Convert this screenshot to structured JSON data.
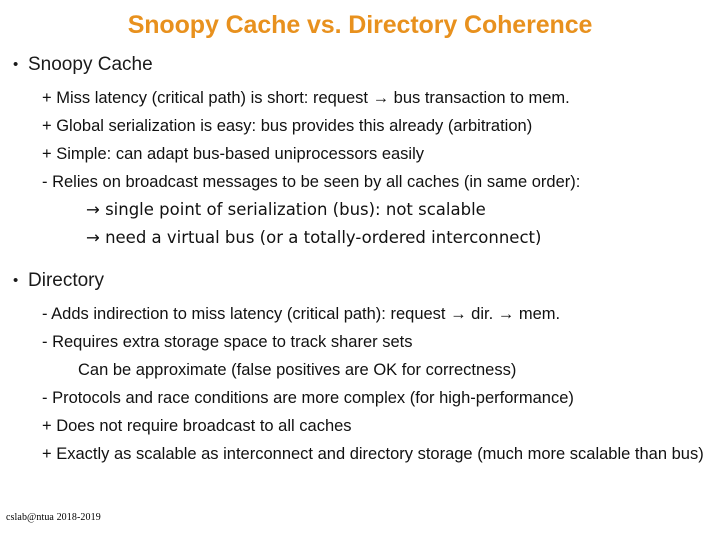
{
  "slide": {
    "title": "Snoopy Cache vs. Directory Coherence",
    "title_color": "#E8911E",
    "background_color": "#FFFFFF",
    "text_color": "#111111"
  },
  "sections": [
    {
      "bullet_glyph": "•",
      "heading": "Snoopy Cache",
      "lines": [
        {
          "level": 2,
          "text": "+ Miss latency (critical path) is short: request → bus transaction to mem."
        },
        {
          "level": 2,
          "text": "+ Global serialization is easy: bus provides this already (arbitration)"
        },
        {
          "level": 2,
          "text": "+ Simple: can adapt bus-based uniprocessors easily"
        },
        {
          "level": 2,
          "text": "- Relies on broadcast messages to be seen by all caches (in same order):"
        },
        {
          "level": 3,
          "text": "→ single point of serialization (bus): not scalable"
        },
        {
          "level": 3,
          "text": "→ need a virtual bus (or a totally-ordered interconnect)"
        }
      ]
    },
    {
      "bullet_glyph": "•",
      "heading": "Directory",
      "lines": [
        {
          "level": 2,
          "text": "- Adds indirection to miss latency (critical path): request → dir. → mem."
        },
        {
          "level": 2,
          "text": "- Requires extra storage space to track sharer sets"
        },
        {
          "level": 3,
          "text": "Can be approximate (false positives are OK for correctness)"
        },
        {
          "level": 2,
          "text": "- Protocols and race conditions are more complex (for high-performance)"
        },
        {
          "level": 2,
          "text": "+ Does not require broadcast to all caches"
        },
        {
          "level": 2,
          "text": "+ Exactly as scalable as interconnect and directory storage (much more scalable than bus)"
        }
      ]
    }
  ],
  "footer": {
    "text": "cslab@ntua 2018-2019"
  }
}
